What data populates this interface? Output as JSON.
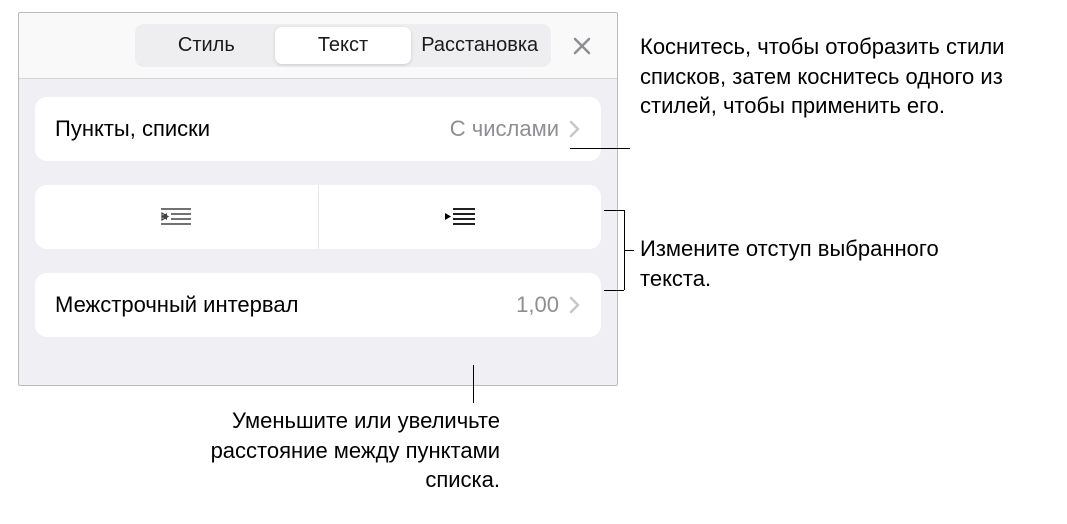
{
  "tabs": {
    "style": "Стиль",
    "text": "Текст",
    "arrange": "Расстановка"
  },
  "rows": {
    "bullets_lists": {
      "label": "Пункты, списки",
      "value": "С числами"
    },
    "line_spacing": {
      "label": "Межстрочный интервал",
      "value": "1,00"
    }
  },
  "callouts": {
    "list_styles": "Коснитесь, чтобы отобразить стили списков, затем коснитесь одного из стилей, чтобы применить его.",
    "indent": "Измените отступ выбранного текста.",
    "spacing": "Уменьшите или увеличьте расстояние между пунктами списка."
  }
}
